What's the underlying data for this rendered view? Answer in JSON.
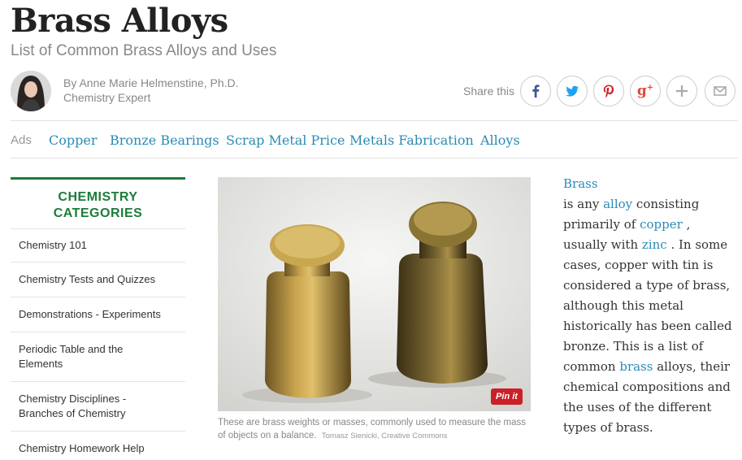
{
  "page": {
    "title": "Brass Alloys",
    "subtitle": "List of Common Brass Alloys and Uses"
  },
  "author": {
    "byline": "By Anne Marie Helmenstine, Ph.D.",
    "role": "Chemistry Expert"
  },
  "share": {
    "label": "Share this",
    "buttons": [
      "facebook-icon",
      "twitter-icon",
      "pinterest-icon",
      "google-plus-icon",
      "plus-icon",
      "mail-icon"
    ]
  },
  "ads": {
    "label": "Ads",
    "links": [
      "Copper",
      "Bronze Bearings",
      "Scrap Metal Price",
      "Metals Fabrication",
      "Alloys"
    ]
  },
  "sidebar": {
    "heading_line1": "CHEMISTRY",
    "heading_line2": "CATEGORIES",
    "items": [
      "Chemistry 101",
      "Chemistry Tests and Quizzes",
      "Demonstrations - Experiments",
      "Periodic Table and the Elements",
      "Chemistry Disciplines - Branches of Chemistry",
      "Chemistry Homework Help"
    ]
  },
  "figure": {
    "pin_label": "Pin it",
    "caption": "These are brass weights or masses, commonly used to measure the mass of objects on a balance.",
    "credit": "Tomasz Sienicki, Creative Commons"
  },
  "article": {
    "link_brass": "Brass",
    "t1": "is any ",
    "link_alloy": "alloy",
    "t2": " consisting primarily of ",
    "link_copper": "copper",
    "t3": " , usually with ",
    "link_zinc": "zinc",
    "t4": " . In some cases, copper with tin is considered a type of brass, although this metal historically has been called bronze. This is a list of common ",
    "link_brass2": "brass",
    "t5": " alloys, their chemical compositions and the uses of the different types of brass."
  },
  "colors": {
    "accent_link": "#2a8bb5",
    "sidebar_green": "#1c7c3a",
    "pinterest_red": "#cb2027"
  }
}
